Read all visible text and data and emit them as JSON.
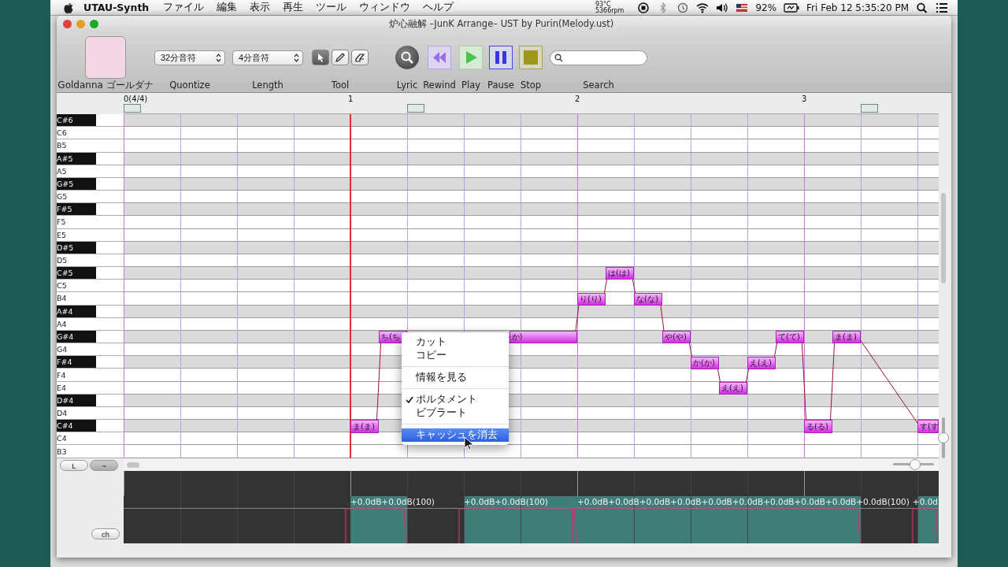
{
  "menubar": {
    "app_name": "UTAU-Synth",
    "menus": [
      "ファイル",
      "編集",
      "表示",
      "再生",
      "ツール",
      "ウィンドウ",
      "ヘルプ"
    ],
    "status_items": [
      {
        "kind": "sensor",
        "lines": [
          "93°C",
          "5366rpm"
        ]
      },
      {
        "kind": "record"
      },
      {
        "kind": "bluetooth"
      },
      {
        "kind": "history"
      },
      {
        "kind": "wifi"
      },
      {
        "kind": "volume"
      },
      {
        "kind": "flag"
      },
      {
        "kind": "text",
        "text": "92%"
      },
      {
        "kind": "battery"
      },
      {
        "kind": "text",
        "text": "Fri Feb 12  5:35:20 PM"
      },
      {
        "kind": "search"
      },
      {
        "kind": "list"
      }
    ]
  },
  "window": {
    "title": "炉心融解 –JunK Arrange– UST by Purin(Melody.ust)"
  },
  "toolbar": [
    {
      "kind": "voicebank",
      "label": "Goldanna ゴールダナ"
    },
    {
      "kind": "dropdown",
      "value": "32分音符",
      "label": "Quontize"
    },
    {
      "kind": "dropdown",
      "value": "4分音符",
      "label": "Length"
    },
    {
      "kind": "tools",
      "label": "Tool",
      "tools": [
        {
          "kind": "pointer",
          "selected": true
        },
        {
          "kind": "pencil",
          "selected": false
        },
        {
          "kind": "eraser",
          "selected": false
        }
      ]
    },
    {
      "kind": "lyric",
      "label": "Lyric"
    },
    {
      "kind": "rewind",
      "label": "Rewind"
    },
    {
      "kind": "play",
      "label": "Play"
    },
    {
      "kind": "pause",
      "label": "Pause"
    },
    {
      "kind": "stop",
      "label": "Stop"
    },
    {
      "kind": "search",
      "label": "Search"
    }
  ],
  "ruler": {
    "measures": [
      "0(4/4)",
      "1",
      "2",
      "3"
    ]
  },
  "keys": [
    {
      "label": "C#6",
      "kind": "black"
    },
    {
      "label": "C6",
      "kind": "white"
    },
    {
      "label": "B5",
      "kind": "white"
    },
    {
      "label": "A#5",
      "kind": "black"
    },
    {
      "label": "A5",
      "kind": "white"
    },
    {
      "label": "G#5",
      "kind": "black"
    },
    {
      "label": "G5",
      "kind": "white"
    },
    {
      "label": "F#5",
      "kind": "black"
    },
    {
      "label": "F5",
      "kind": "white"
    },
    {
      "label": "E5",
      "kind": "white"
    },
    {
      "label": "D#5",
      "kind": "black"
    },
    {
      "label": "D5",
      "kind": "white"
    },
    {
      "label": "C#5",
      "kind": "black"
    },
    {
      "label": "C5",
      "kind": "white"
    },
    {
      "label": "B4",
      "kind": "white"
    },
    {
      "label": "A#4",
      "kind": "black"
    },
    {
      "label": "A4",
      "kind": "white"
    },
    {
      "label": "G#4",
      "kind": "black"
    },
    {
      "label": "G4",
      "kind": "white"
    },
    {
      "label": "F#4",
      "kind": "black"
    },
    {
      "label": "F4",
      "kind": "white"
    },
    {
      "label": "E4",
      "kind": "white"
    },
    {
      "label": "D#4",
      "kind": "black"
    },
    {
      "label": "D4",
      "kind": "white"
    },
    {
      "label": "C#4",
      "kind": "black"
    },
    {
      "label": "C4",
      "kind": "white"
    },
    {
      "label": "B3",
      "kind": "white"
    }
  ],
  "notes": [
    {
      "lyric": "ま(ま)"
    },
    {
      "lyric": "ち(ち"
    },
    {
      "lyric": "か)"
    },
    {
      "lyric": "り(り)"
    },
    {
      "lyric": "は(は)"
    },
    {
      "lyric": "な(な)"
    },
    {
      "lyric": "や(や)"
    },
    {
      "lyric": "か(か)"
    },
    {
      "lyric": "え(え)"
    },
    {
      "lyric": "え(え)"
    },
    {
      "lyric": "て(て)"
    },
    {
      "lyric": "る(る)"
    },
    {
      "lyric": "ま(ま)"
    },
    {
      "lyric": "す(す"
    }
  ],
  "context_menu": [
    {
      "kind": "item",
      "label": "カット",
      "checked": false,
      "selected": false
    },
    {
      "kind": "item",
      "label": "コピー",
      "checked": false,
      "selected": false
    },
    {
      "kind": "separator"
    },
    {
      "kind": "item",
      "label": "情報を見る",
      "checked": false,
      "selected": false
    },
    {
      "kind": "separator"
    },
    {
      "kind": "item",
      "label": "ポルタメント",
      "checked": true,
      "selected": false
    },
    {
      "kind": "item",
      "label": "ビブラート",
      "checked": false,
      "selected": false
    },
    {
      "kind": "separator"
    },
    {
      "kind": "item",
      "label": "キャッシュを消去",
      "checked": false,
      "selected": true
    }
  ],
  "side_buttons": [
    "L",
    "~"
  ],
  "channel_button": "ch",
  "zoom_slider": {
    "level": 0.55
  },
  "vertical_slider": {
    "level": 0.5
  },
  "envelope_labels": [
    "+0.0dB+0.0dB(100)",
    "+0.0dB+0.0dB(100)",
    "+0.0dB+0.0dB+0.0dB+0.0dB+0.0dB+0.0dB+0.0dB+0.0dB+0.0dB+0.0dB(100)",
    "+0.0d"
  ]
}
